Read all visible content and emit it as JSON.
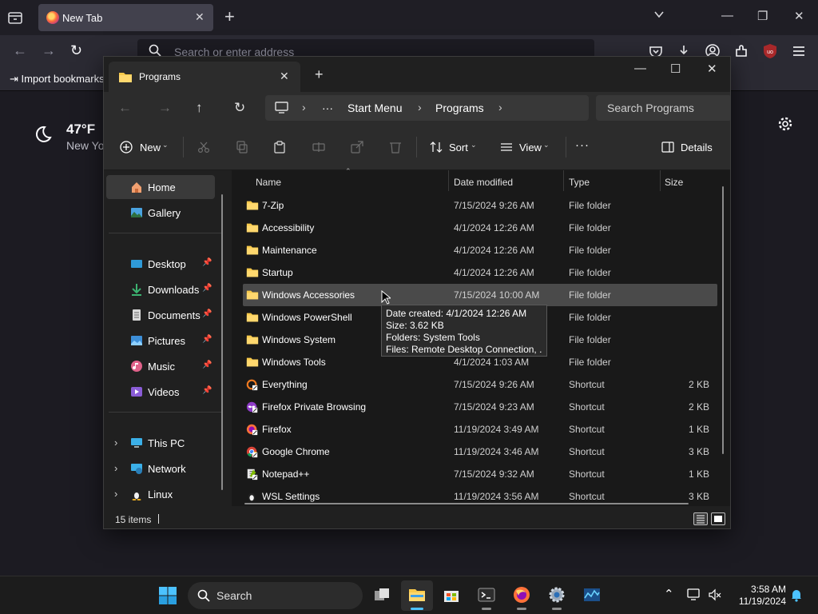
{
  "browser": {
    "tab_title": "New Tab",
    "url_placeholder": "Search or enter address",
    "bookmarks_import": "Import bookmarks",
    "weather": {
      "temp": "47°F",
      "location": "New Yo"
    },
    "colors": {
      "toolbar": "#2b2a33",
      "tabstrip": "#1f1e25",
      "ublock_red": "#a8282a"
    }
  },
  "explorer": {
    "tab_title": "Programs",
    "breadcrumb": [
      "Start Menu",
      "Programs"
    ],
    "breadcrumb_more": "···",
    "search_placeholder": "Search Programs",
    "commands": {
      "new": "New",
      "sort": "Sort",
      "view": "View",
      "more": "···",
      "details": "Details"
    },
    "nav": {
      "home": "Home",
      "gallery": "Gallery",
      "desktop": "Desktop",
      "downloads": "Downloads",
      "documents": "Documents",
      "pictures": "Pictures",
      "music": "Music",
      "videos": "Videos",
      "this_pc": "This PC",
      "network": "Network",
      "linux": "Linux"
    },
    "columns": {
      "name": "Name",
      "date": "Date modified",
      "type": "Type",
      "size": "Size"
    },
    "files": [
      {
        "name": "7-Zip",
        "date": "7/15/2024 9:26 AM",
        "type": "File folder",
        "size": "",
        "icon": "folder-icon"
      },
      {
        "name": "Accessibility",
        "date": "4/1/2024 12:26 AM",
        "type": "File folder",
        "size": "",
        "icon": "folder-icon"
      },
      {
        "name": "Maintenance",
        "date": "4/1/2024 12:26 AM",
        "type": "File folder",
        "size": "",
        "icon": "folder-icon"
      },
      {
        "name": "Startup",
        "date": "4/1/2024 12:26 AM",
        "type": "File folder",
        "size": "",
        "icon": "folder-icon"
      },
      {
        "name": "Windows Accessories",
        "date": "7/15/2024 10:00 AM",
        "type": "File folder",
        "size": "",
        "icon": "folder-icon"
      },
      {
        "name": "Windows PowerShell",
        "date": "",
        "type": "File folder",
        "size": "",
        "icon": "folder-icon"
      },
      {
        "name": "Windows System",
        "date": "",
        "type": "File folder",
        "size": "",
        "icon": "folder-icon"
      },
      {
        "name": "Windows Tools",
        "date": "4/1/2024 1:03 AM",
        "type": "File folder",
        "size": "",
        "icon": "folder-icon"
      },
      {
        "name": "Everything",
        "date": "7/15/2024 9:26 AM",
        "type": "Shortcut",
        "size": "2 KB",
        "icon": "everything-icon"
      },
      {
        "name": "Firefox Private Browsing",
        "date": "7/15/2024 9:23 AM",
        "type": "Shortcut",
        "size": "2 KB",
        "icon": "firefox-private-icon"
      },
      {
        "name": "Firefox",
        "date": "11/19/2024 3:49 AM",
        "type": "Shortcut",
        "size": "1 KB",
        "icon": "firefox-icon"
      },
      {
        "name": "Google Chrome",
        "date": "11/19/2024 3:46 AM",
        "type": "Shortcut",
        "size": "3 KB",
        "icon": "chrome-icon"
      },
      {
        "name": "Notepad++",
        "date": "7/15/2024 9:32 AM",
        "type": "Shortcut",
        "size": "1 KB",
        "icon": "notepad-plus-plus-icon"
      },
      {
        "name": "WSL Settings",
        "date": "11/19/2024 3:56 AM",
        "type": "Shortcut",
        "size": "3 KB",
        "icon": "wsl-icon"
      }
    ],
    "tooltip": [
      "Date created: 4/1/2024 12:26 AM",
      "Size: 3.62 KB",
      "Folders: System Tools",
      "Files: Remote Desktop Connection, ..."
    ],
    "status": {
      "count": "15 items"
    }
  },
  "taskbar": {
    "search_placeholder": "Search",
    "time": "3:58 AM",
    "date": "11/19/2024"
  }
}
